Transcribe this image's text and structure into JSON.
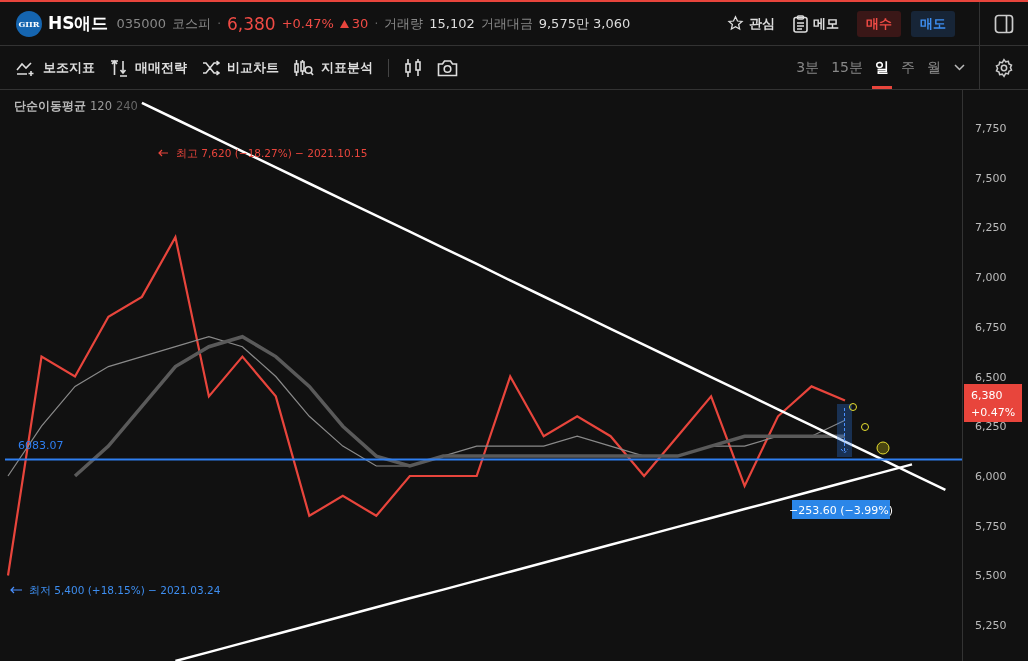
{
  "stock": {
    "logo_text": "GIIR",
    "name": "HS애드",
    "code": "035000",
    "market": "코스피",
    "price": "6,380",
    "change_pct": "+0.47%",
    "change": "30",
    "volume_label": "거래량",
    "volume": "15,102",
    "amount_label": "거래대금",
    "amount": "9,575만 3,060",
    "separator": "·"
  },
  "actions": [
    {
      "kind": "star",
      "label": "관심"
    },
    {
      "kind": "memo",
      "label": "메모"
    },
    {
      "kind": "buy",
      "label": "매수"
    },
    {
      "kind": "sell",
      "label": "매도"
    }
  ],
  "tools": [
    {
      "kind": "indicator",
      "label": "보조지표"
    },
    {
      "kind": "strategy",
      "label": "매매전략"
    },
    {
      "kind": "compare",
      "label": "비교차트"
    },
    {
      "kind": "analysis",
      "label": "지표분석"
    }
  ],
  "periods": [
    {
      "label": "3분",
      "selected": false
    },
    {
      "label": "15분",
      "selected": false
    },
    {
      "label": "일",
      "selected": true
    },
    {
      "label": "주",
      "selected": false
    },
    {
      "label": "월",
      "selected": false
    }
  ],
  "indicator": {
    "name": "단순이동평균"
  },
  "chart": {
    "chart_data": {
      "type": "line",
      "ylim": [
        5060,
        7940
      ],
      "yticks": [
        {
          "value": 5250,
          "label": "5,250"
        },
        {
          "value": 5500,
          "label": "5,500"
        },
        {
          "value": 5750,
          "label": "5,750"
        },
        {
          "value": 6000,
          "label": "6,000"
        },
        {
          "value": 6250,
          "label": "6,250"
        },
        {
          "value": 6500,
          "label": "6,500"
        },
        {
          "value": 6750,
          "label": "6,750"
        },
        {
          "value": 7000,
          "label": "7,000"
        },
        {
          "value": 7250,
          "label": "7,250"
        },
        {
          "value": 7500,
          "label": "7,500"
        },
        {
          "value": 7750,
          "label": "7,750"
        }
      ],
      "ref_lines": [
        {
          "axis": "y",
          "value": 6083.07,
          "color": "#2f7ff0"
        }
      ],
      "series": [
        {
          "color": "#e8453c",
          "values": [
            5500,
            6600,
            6500,
            6800,
            6900,
            7200,
            6400,
            6600,
            6400,
            5800,
            5900,
            5800,
            6000,
            6000,
            6000,
            6500,
            6200,
            6300,
            6200,
            6000,
            6200,
            6400,
            5950,
            6300,
            6450,
            6380,
            null,
            null,
            null
          ]
        },
        {
          "name": "120",
          "color": "#8a8a8a",
          "values": [
            6000,
            6250,
            6450,
            6550,
            6600,
            6650,
            6700,
            6650,
            6500,
            6300,
            6150,
            6050,
            6050,
            6100,
            6150,
            6150,
            6150,
            6200,
            6150,
            6100,
            6100,
            6150,
            6150,
            6200,
            6200,
            6280,
            null,
            null,
            null
          ]
        },
        {
          "name": "240",
          "color": "#5a5a5a",
          "values": [
            null,
            null,
            6000,
            6150,
            6350,
            6550,
            6650,
            6700,
            6600,
            6450,
            6250,
            6100,
            6050,
            6100,
            6100,
            6100,
            6100,
            6100,
            6100,
            6100,
            6100,
            6150,
            6200,
            6200,
            6200,
            6200,
            null,
            null,
            null
          ]
        },
        {
          "color": "#ffffff",
          "values": [
            null,
            null,
            null,
            null,
            7875,
            7794,
            7713,
            7632,
            7551,
            7470,
            7389,
            7308,
            7228,
            7147,
            7066,
            6983,
            6902,
            6821,
            6740,
            6659,
            6578,
            6497,
            6416,
            6335,
            6254,
            6173,
            6092,
            6011,
            5930
          ]
        },
        {
          "color": "#ffffff",
          "values": [
            null,
            null,
            null,
            null,
            null,
            5070,
            5115,
            5160,
            5205,
            5250,
            5295,
            5340,
            5385,
            5429,
            5474,
            5519,
            5564,
            5609,
            5654,
            5699,
            5744,
            5789,
            5834,
            5878,
            5923,
            5968,
            6013,
            6058,
            null
          ]
        }
      ]
    },
    "high_label": "최고 7,620 (−18.27%) − 2021.10.15",
    "low_label": "최저 5,400 (+18.15%) − 2021.03.24",
    "level_label": "6083.07",
    "measure_label": "−253.60 (−3.99%)",
    "price_tag": "6,380",
    "price_tag_change": "+0.47%"
  }
}
